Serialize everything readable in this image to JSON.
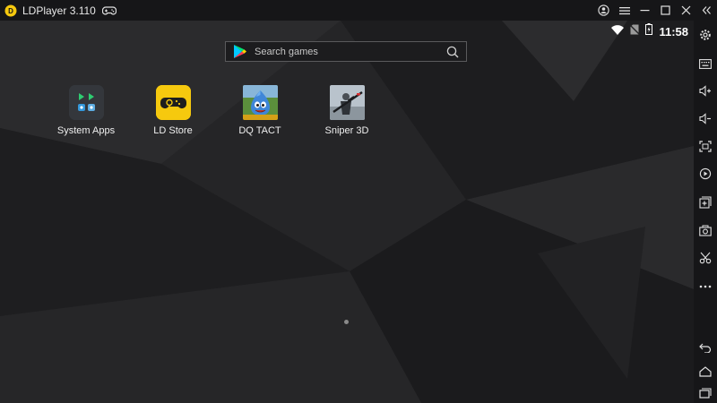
{
  "window": {
    "title": "LDPlayer 3.110"
  },
  "status": {
    "time": "11:58"
  },
  "search": {
    "placeholder": "Search games"
  },
  "apps": [
    {
      "label": "System Apps"
    },
    {
      "label": "LD Store"
    },
    {
      "label": "DQ TACT"
    },
    {
      "label": "Sniper 3D"
    }
  ],
  "colors": {
    "accent": "#f6c90e",
    "titlebar": "#161618",
    "screen": "#232325"
  }
}
